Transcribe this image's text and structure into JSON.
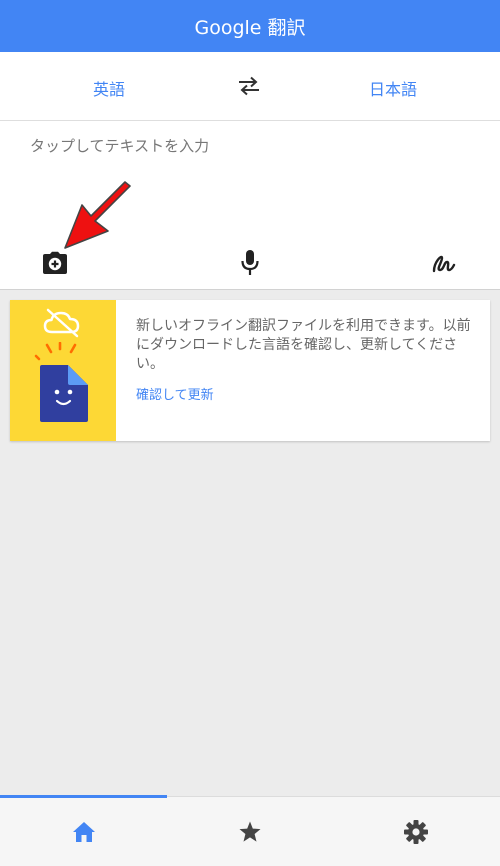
{
  "header": {
    "title": "Google 翻訳"
  },
  "languages": {
    "source": "英語",
    "target": "日本語"
  },
  "input": {
    "placeholder": "タップしてテキストを入力"
  },
  "tools": [
    "camera-icon",
    "mic-icon",
    "handwriting-icon"
  ],
  "offline_card": {
    "message": "新しいオフライン翻訳ファイルを利用できます。以前にダウンロードした言語を確認し、更新してください。",
    "link": "確認して更新",
    "accent_color": "#fdd835"
  },
  "bottom_nav": {
    "items": [
      "home-icon",
      "star-icon",
      "settings-icon"
    ],
    "active": "home-icon",
    "accent_color": "#4285f4"
  }
}
